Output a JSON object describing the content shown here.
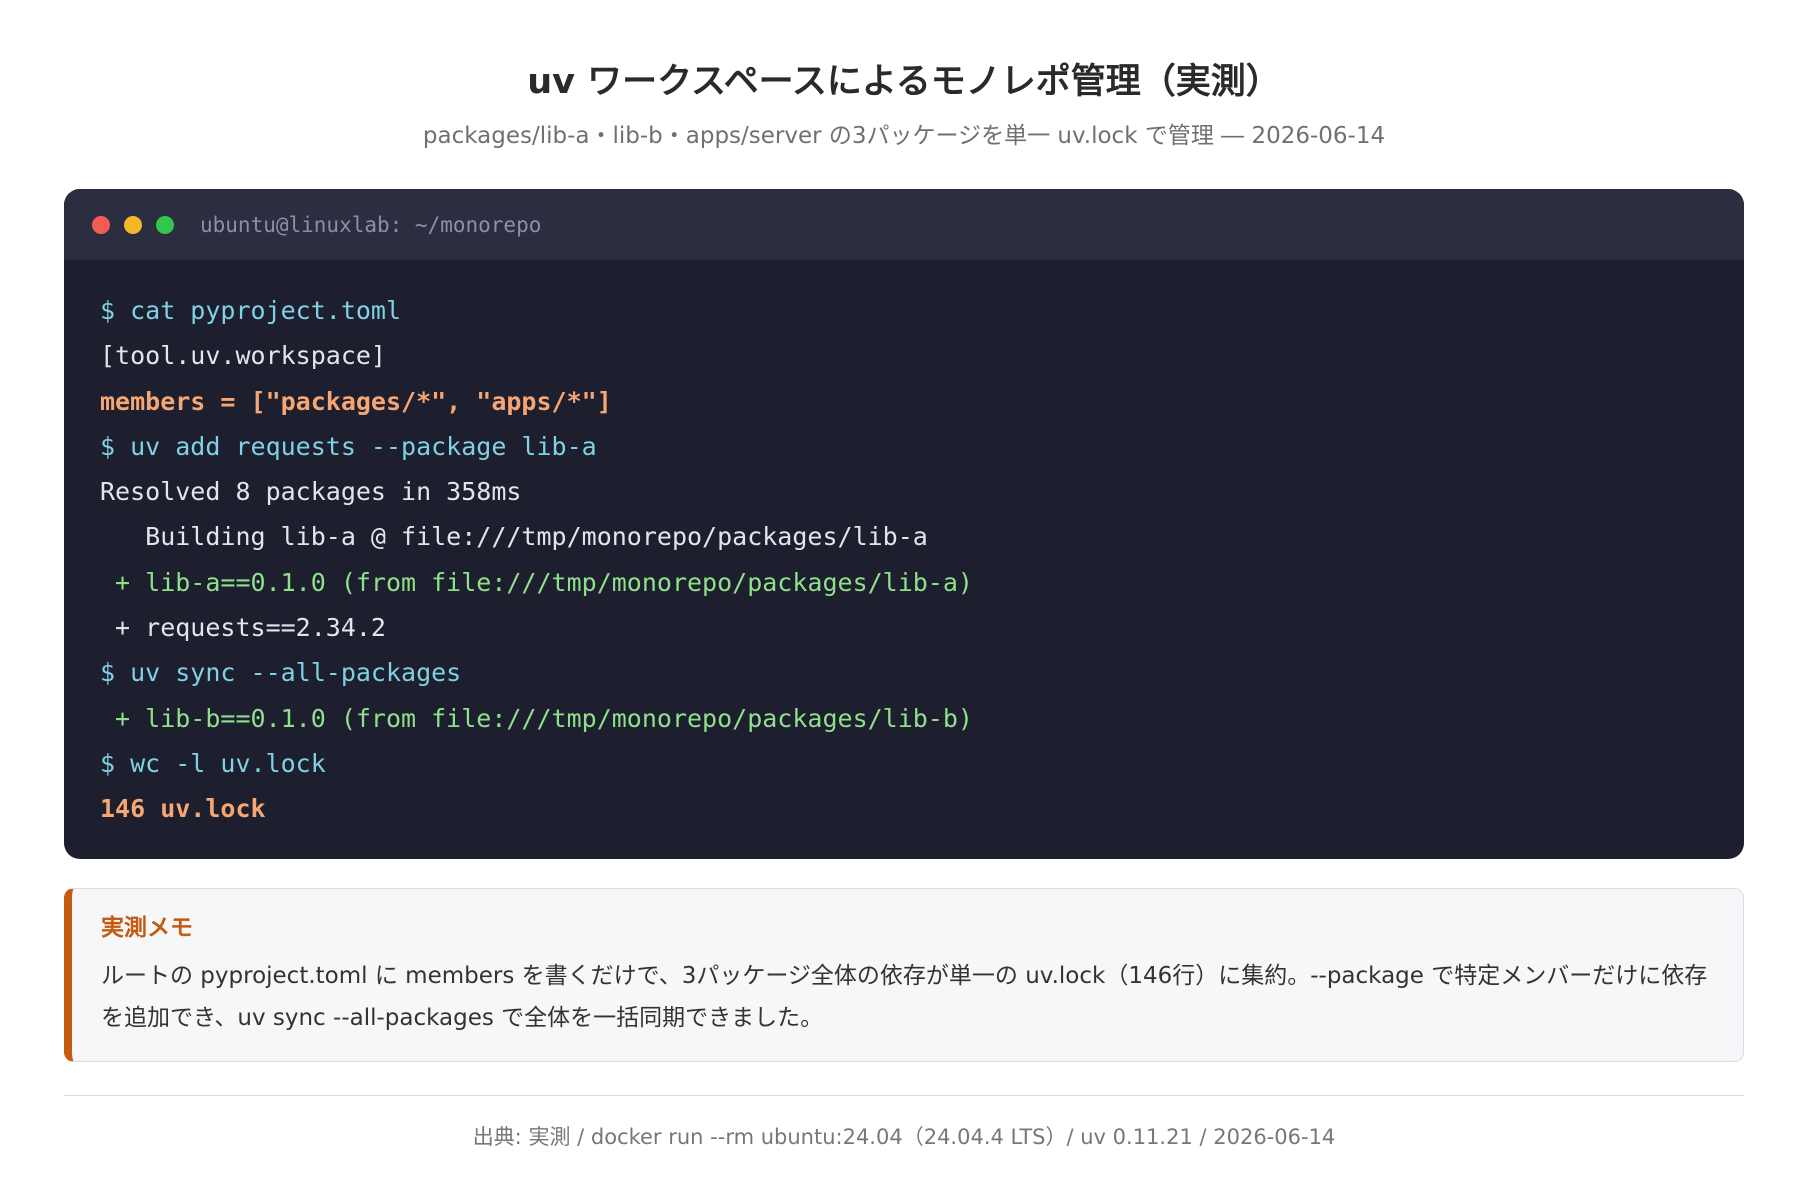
{
  "header": {
    "title": "uv ワークスペースによるモノレポ管理（実測）",
    "subtitle": "packages/lib-a・lib-b・apps/server の3パッケージを単一 uv.lock で管理 ― 2026-06-14"
  },
  "terminal": {
    "title": "ubuntu@linuxlab: ~/monorepo",
    "lines": [
      {
        "text": "$ cat pyproject.toml",
        "kind": "cmd"
      },
      {
        "text": "[tool.uv.workspace]",
        "kind": "plain"
      },
      {
        "text": "members = [\"packages/*\", \"apps/*\"]",
        "kind": "warn"
      },
      {
        "text": "$ uv add requests --package lib-a",
        "kind": "cmd"
      },
      {
        "text": "Resolved 8 packages in 358ms",
        "kind": "plain"
      },
      {
        "text": "   Building lib-a @ file:///tmp/monorepo/packages/lib-a",
        "kind": "plain"
      },
      {
        "text": " + lib-a==0.1.0 (from file:///tmp/monorepo/packages/lib-a)",
        "kind": "add"
      },
      {
        "text": " + requests==2.34.2",
        "kind": "plain"
      },
      {
        "text": "$ uv sync --all-packages",
        "kind": "cmd"
      },
      {
        "text": " + lib-b==0.1.0 (from file:///tmp/monorepo/packages/lib-b)",
        "kind": "add"
      },
      {
        "text": "$ wc -l uv.lock",
        "kind": "cmd"
      },
      {
        "text": "146 uv.lock",
        "kind": "warn"
      }
    ]
  },
  "memo": {
    "title": "実測メモ",
    "text": "ルートの pyproject.toml に members を書くだけで、3パッケージ全体の依存が単一の uv.lock（146行）に集約。--package で特定メンバーだけに依存を追加でき、uv sync --all-packages で全体を一括同期できました。"
  },
  "footer": {
    "source": "出典: 実測 / docker run --rm ubuntu:24.04（24.04.4 LTS）/ uv 0.11.21 / 2026-06-14"
  },
  "colors": {
    "terminal_bg": "#1d1e2e",
    "terminal_bar": "#2c2d40",
    "command": "#7fd1e3",
    "highlight": "#f5a673",
    "added": "#8ee08a",
    "accent": "#c55a11"
  }
}
